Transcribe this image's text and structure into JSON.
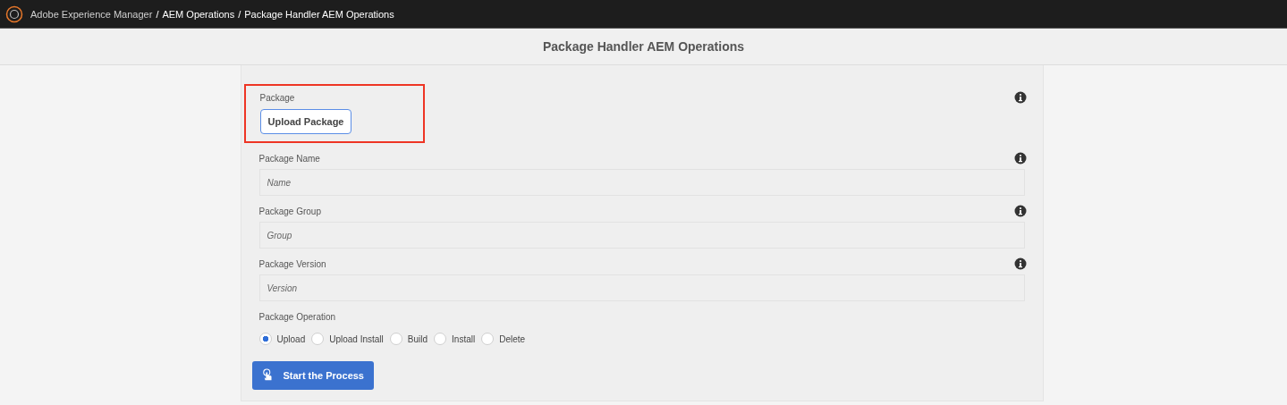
{
  "top_bar": {
    "separator": "/",
    "breadcrumb": [
      "Adobe Experience Manager",
      "AEM Operations",
      "Package Handler AEM Operations"
    ]
  },
  "page_title": "Package Handler AEM Operations",
  "form": {
    "package": {
      "label": "Package",
      "button": "Upload Package",
      "highlighted": true
    },
    "fields": [
      {
        "label": "Package Name",
        "placeholder": "Name"
      },
      {
        "label": "Package Group",
        "placeholder": "Group"
      },
      {
        "label": "Package Version",
        "placeholder": "Version"
      }
    ],
    "operation": {
      "label": "Package Operation",
      "options": [
        {
          "label": "Upload",
          "selected": true
        },
        {
          "label": "Upload Install",
          "selected": false
        },
        {
          "label": "Build",
          "selected": false
        },
        {
          "label": "Install",
          "selected": false
        },
        {
          "label": "Delete",
          "selected": false
        }
      ]
    },
    "submit": "Start the Process"
  }
}
